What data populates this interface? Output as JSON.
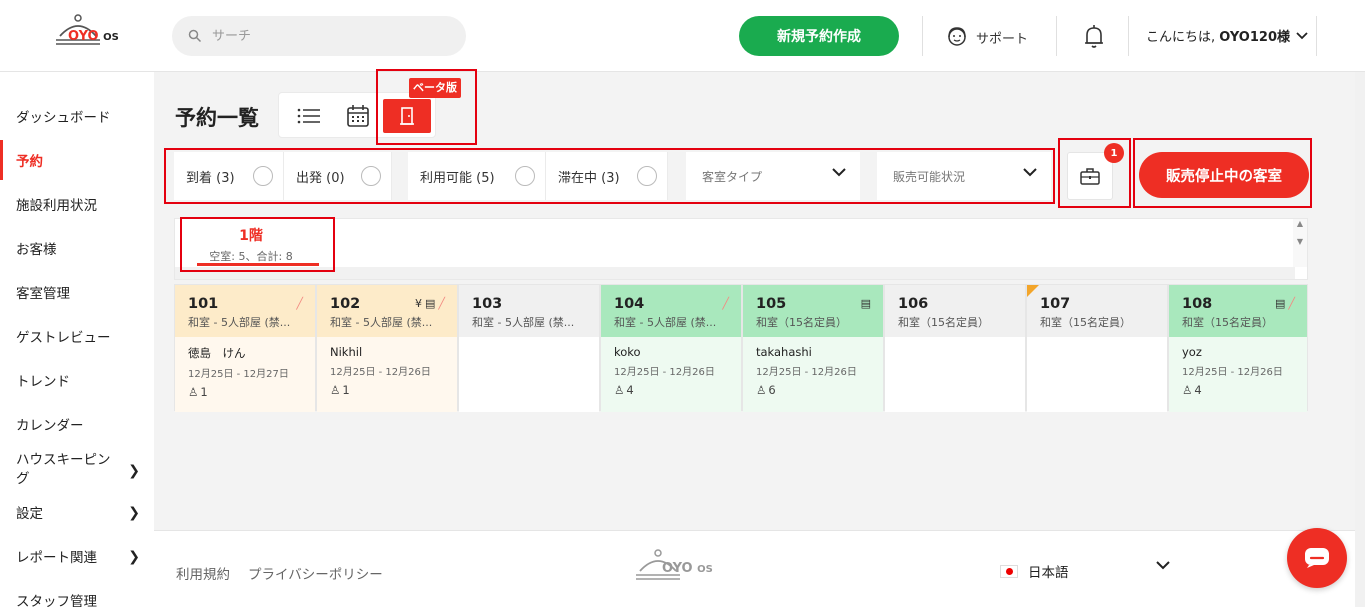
{
  "header": {
    "logo_brand": "OYO",
    "logo_suffix": "OS",
    "search_placeholder": "サーチ",
    "new_reservation": "新規予約作成",
    "support": "サポート",
    "greeting_prefix": "こんにちは, ",
    "greeting_user": "OYO120様"
  },
  "sidebar": {
    "items": [
      {
        "label": "ダッシュボード"
      },
      {
        "label": "予約"
      },
      {
        "label": "施設利用状況"
      },
      {
        "label": "お客様"
      },
      {
        "label": "客室管理"
      },
      {
        "label": "ゲストレビュー"
      },
      {
        "label": "トレンド"
      },
      {
        "label": "カレンダー"
      },
      {
        "label": "ハウスキーピング"
      },
      {
        "label": "設定"
      },
      {
        "label": "レポート関連"
      },
      {
        "label": "スタッフ管理"
      }
    ],
    "active_index": 1
  },
  "main": {
    "title": "予約一覧",
    "beta": "ベータ版",
    "filters": [
      {
        "label": "到着 (3)"
      },
      {
        "label": "出発 (0)"
      },
      {
        "label": "利用可能 (5)"
      },
      {
        "label": "滞在中 (3)"
      }
    ],
    "room_type_select": "客室タイプ",
    "availability_select": "販売可能状況",
    "notifications_count": "1",
    "stop_sale_button": "販売停止中の客室"
  },
  "floor": {
    "name": "1階",
    "summary": "空室: 5、合計: 8"
  },
  "rooms": [
    {
      "number": "101",
      "type": "和室 - 5人部屋 (禁...",
      "status": "orange",
      "icons": [
        "broom"
      ],
      "guest": "徳島　けん",
      "dates": "12月25日 - 12月27日",
      "pax": "1"
    },
    {
      "number": "102",
      "type": "和室 - 5人部屋 (禁...",
      "status": "orange",
      "icons": [
        "yen",
        "doc",
        "broom"
      ],
      "guest": "Nikhil",
      "dates": "12月25日 - 12月26日",
      "pax": "1"
    },
    {
      "number": "103",
      "type": "和室 - 5人部屋 (禁...",
      "status": "grey",
      "icons": [],
      "guest": "",
      "dates": "",
      "pax": ""
    },
    {
      "number": "104",
      "type": "和室 - 5人部屋 (禁...",
      "status": "green",
      "icons": [
        "broom"
      ],
      "guest": "koko",
      "dates": "12月25日 - 12月26日",
      "pax": "4"
    },
    {
      "number": "105",
      "type": "和室（15名定員）",
      "status": "green",
      "icons": [
        "doc"
      ],
      "guest": "takahashi",
      "dates": "12月25日 - 12月26日",
      "pax": "6"
    },
    {
      "number": "106",
      "type": "和室（15名定員）",
      "status": "grey",
      "icons": [],
      "guest": "",
      "dates": "",
      "pax": ""
    },
    {
      "number": "107",
      "type": "和室（15名定員）",
      "status": "grey",
      "icons": [],
      "guest": "",
      "dates": "",
      "pax": "",
      "flag": true
    },
    {
      "number": "108",
      "type": "和室（15名定員）",
      "status": "green",
      "icons": [
        "doc",
        "broom"
      ],
      "guest": "yoz",
      "dates": "12月25日 - 12月26日",
      "pax": "4"
    }
  ],
  "footer": {
    "terms": "利用規約",
    "privacy": "プライバシーポリシー",
    "language": "日本語"
  },
  "colors": {
    "brand_red": "#ee2e24",
    "green_button": "#1aab4f",
    "occupied_orange": "#fdebc9",
    "checked_in_green": "#a9e8bd"
  }
}
